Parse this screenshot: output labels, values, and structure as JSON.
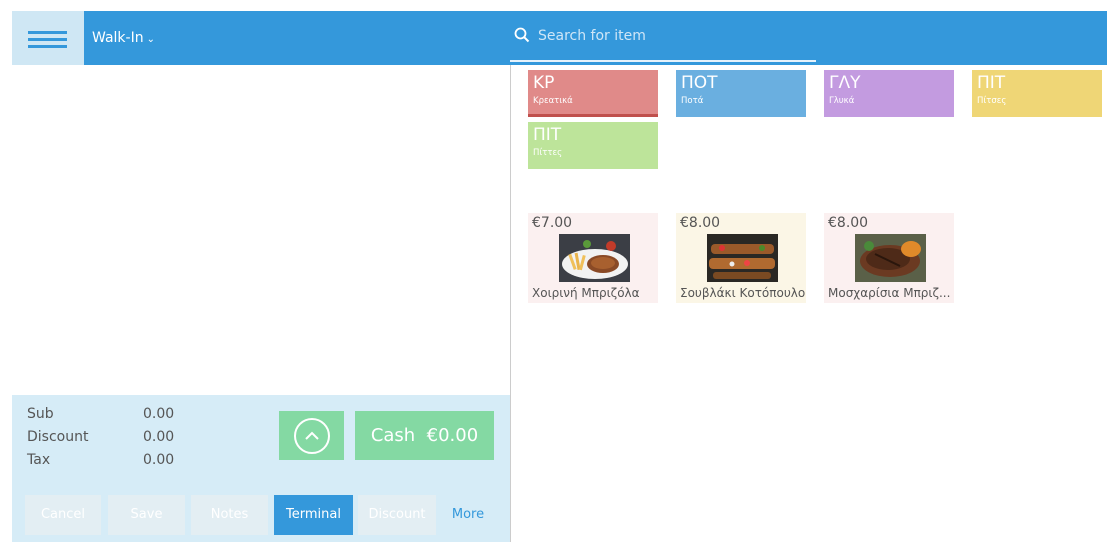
{
  "header": {
    "order_type": "Walk-In",
    "search_placeholder": "Search for item"
  },
  "totals": {
    "sub_label": "Sub",
    "sub_value": "0.00",
    "discount_label": "Discount",
    "discount_value": "0.00",
    "tax_label": "Tax",
    "tax_value": "0.00"
  },
  "actions": {
    "cash_label": "Cash",
    "cash_amount": "€0.00",
    "cancel": "Cancel",
    "save": "Save",
    "notes": "Notes",
    "terminal": "Terminal",
    "discount": "Discount",
    "more": "More"
  },
  "categories": [
    {
      "code": "ΚΡ",
      "name": "Κρεατικά",
      "color": "#e08a89"
    },
    {
      "code": "ΠΟΤ",
      "name": "Ποτά",
      "color": "#6aafe0"
    },
    {
      "code": "ΓΛΥ",
      "name": "Γλυκά",
      "color": "#c39be0"
    },
    {
      "code": "ΠΙΤ",
      "name": "Πίτσες",
      "color": "#efd676"
    },
    {
      "code": "ΠΙΤ",
      "name": "Πίττες",
      "color": "#bde49a"
    }
  ],
  "items": [
    {
      "price": "€7.00",
      "name": "Χοιρινή Μπριζόλα",
      "bg": "#fbf0f0",
      "icon": "pork-chop-plate-image"
    },
    {
      "price": "€8.00",
      "name": "Σουβλάκι Κοτόπουλο",
      "bg": "#fbf6e6",
      "icon": "chicken-souvlaki-image"
    },
    {
      "price": "€8.00",
      "name": "Μοσχαρίσια Μπριζ...",
      "bg": "#fbf0f0",
      "icon": "beef-steak-image"
    }
  ],
  "colors": {
    "primary": "#3498db",
    "success": "#84d9a3",
    "panel": "#d6ecf7"
  }
}
